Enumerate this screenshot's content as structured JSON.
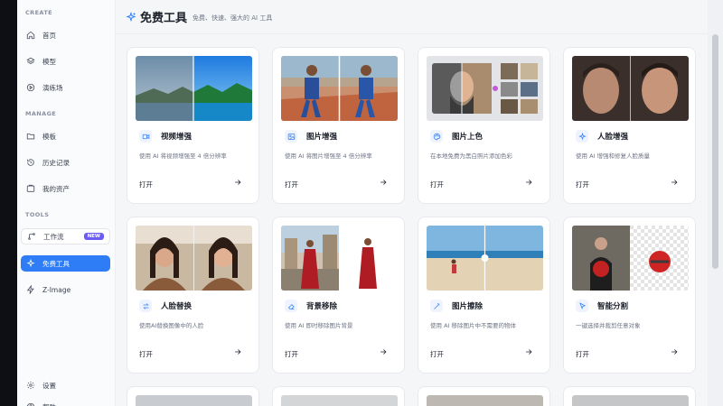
{
  "sidebar": {
    "sections": {
      "create": "CREATE",
      "manage": "MANAGE",
      "tools": "TOOLS"
    },
    "items": [
      {
        "label": "首页"
      },
      {
        "label": "模型"
      },
      {
        "label": "演练场"
      },
      {
        "label": "模板"
      },
      {
        "label": "历史记录"
      },
      {
        "label": "我的资产"
      },
      {
        "label": "工作流",
        "badge": "NEW"
      },
      {
        "label": "免费工具",
        "active": true
      },
      {
        "label": "Z-Image"
      },
      {
        "label": "设置"
      },
      {
        "label": "帮助"
      }
    ]
  },
  "header": {
    "title": "免费工具",
    "subtitle": "免费、快速、强大的 AI 工具"
  },
  "cards": [
    {
      "title": "视频增强",
      "desc": "使用 AI 将视频增强至 4 倍分辨率",
      "open": "打开",
      "icon": "video-icon"
    },
    {
      "title": "图片增强",
      "desc": "使用 AI 将图片增强至 4 倍分辨率",
      "open": "打开",
      "icon": "image-icon"
    },
    {
      "title": "图片上色",
      "desc": "在本地免费为黑白照片添加色彩",
      "open": "打开",
      "icon": "palette-icon"
    },
    {
      "title": "人脸增强",
      "desc": "使用 AI 增强和修复人脸质量",
      "open": "打开",
      "icon": "sparkle-icon"
    },
    {
      "title": "人脸替换",
      "desc": "使用AI替换图像中的人脸",
      "open": "打开",
      "icon": "swap-icon"
    },
    {
      "title": "背景移除",
      "desc": "使用 AI 即时移除图片背景",
      "open": "打开",
      "icon": "eraser-icon"
    },
    {
      "title": "图片擦除",
      "desc": "使用 AI 移除图片中不需要的物体",
      "open": "打开",
      "icon": "wand-icon"
    },
    {
      "title": "智能分割",
      "desc": "一键选择并裁剪任意对象",
      "open": "打开",
      "icon": "cursor-icon"
    }
  ],
  "colors": {
    "accent": "#2f7df6",
    "badge": "#6b5cf6"
  }
}
